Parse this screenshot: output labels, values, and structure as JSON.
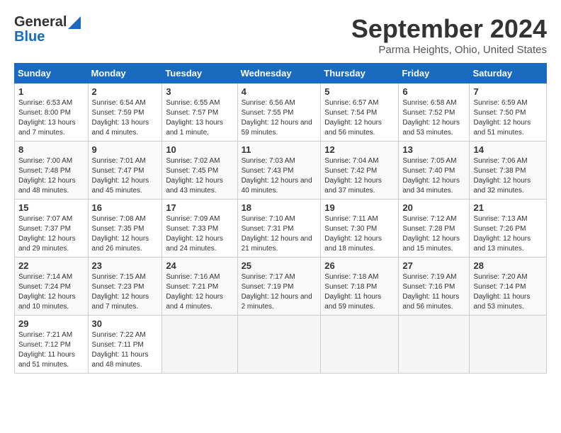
{
  "header": {
    "logo_general": "General",
    "logo_blue": "Blue",
    "title": "September 2024",
    "location": "Parma Heights, Ohio, United States"
  },
  "days_of_week": [
    "Sunday",
    "Monday",
    "Tuesday",
    "Wednesday",
    "Thursday",
    "Friday",
    "Saturday"
  ],
  "weeks": [
    [
      {
        "day": 1,
        "sunrise": "6:53 AM",
        "sunset": "8:00 PM",
        "daylight": "13 hours and 7 minutes"
      },
      {
        "day": 2,
        "sunrise": "6:54 AM",
        "sunset": "7:59 PM",
        "daylight": "13 hours and 4 minutes"
      },
      {
        "day": 3,
        "sunrise": "6:55 AM",
        "sunset": "7:57 PM",
        "daylight": "13 hours and 1 minute"
      },
      {
        "day": 4,
        "sunrise": "6:56 AM",
        "sunset": "7:55 PM",
        "daylight": "12 hours and 59 minutes"
      },
      {
        "day": 5,
        "sunrise": "6:57 AM",
        "sunset": "7:54 PM",
        "daylight": "12 hours and 56 minutes"
      },
      {
        "day": 6,
        "sunrise": "6:58 AM",
        "sunset": "7:52 PM",
        "daylight": "12 hours and 53 minutes"
      },
      {
        "day": 7,
        "sunrise": "6:59 AM",
        "sunset": "7:50 PM",
        "daylight": "12 hours and 51 minutes"
      }
    ],
    [
      {
        "day": 8,
        "sunrise": "7:00 AM",
        "sunset": "7:48 PM",
        "daylight": "12 hours and 48 minutes"
      },
      {
        "day": 9,
        "sunrise": "7:01 AM",
        "sunset": "7:47 PM",
        "daylight": "12 hours and 45 minutes"
      },
      {
        "day": 10,
        "sunrise": "7:02 AM",
        "sunset": "7:45 PM",
        "daylight": "12 hours and 43 minutes"
      },
      {
        "day": 11,
        "sunrise": "7:03 AM",
        "sunset": "7:43 PM",
        "daylight": "12 hours and 40 minutes"
      },
      {
        "day": 12,
        "sunrise": "7:04 AM",
        "sunset": "7:42 PM",
        "daylight": "12 hours and 37 minutes"
      },
      {
        "day": 13,
        "sunrise": "7:05 AM",
        "sunset": "7:40 PM",
        "daylight": "12 hours and 34 minutes"
      },
      {
        "day": 14,
        "sunrise": "7:06 AM",
        "sunset": "7:38 PM",
        "daylight": "12 hours and 32 minutes"
      }
    ],
    [
      {
        "day": 15,
        "sunrise": "7:07 AM",
        "sunset": "7:37 PM",
        "daylight": "12 hours and 29 minutes"
      },
      {
        "day": 16,
        "sunrise": "7:08 AM",
        "sunset": "7:35 PM",
        "daylight": "12 hours and 26 minutes"
      },
      {
        "day": 17,
        "sunrise": "7:09 AM",
        "sunset": "7:33 PM",
        "daylight": "12 hours and 24 minutes"
      },
      {
        "day": 18,
        "sunrise": "7:10 AM",
        "sunset": "7:31 PM",
        "daylight": "12 hours and 21 minutes"
      },
      {
        "day": 19,
        "sunrise": "7:11 AM",
        "sunset": "7:30 PM",
        "daylight": "12 hours and 18 minutes"
      },
      {
        "day": 20,
        "sunrise": "7:12 AM",
        "sunset": "7:28 PM",
        "daylight": "12 hours and 15 minutes"
      },
      {
        "day": 21,
        "sunrise": "7:13 AM",
        "sunset": "7:26 PM",
        "daylight": "12 hours and 13 minutes"
      }
    ],
    [
      {
        "day": 22,
        "sunrise": "7:14 AM",
        "sunset": "7:24 PM",
        "daylight": "12 hours and 10 minutes"
      },
      {
        "day": 23,
        "sunrise": "7:15 AM",
        "sunset": "7:23 PM",
        "daylight": "12 hours and 7 minutes"
      },
      {
        "day": 24,
        "sunrise": "7:16 AM",
        "sunset": "7:21 PM",
        "daylight": "12 hours and 4 minutes"
      },
      {
        "day": 25,
        "sunrise": "7:17 AM",
        "sunset": "7:19 PM",
        "daylight": "12 hours and 2 minutes"
      },
      {
        "day": 26,
        "sunrise": "7:18 AM",
        "sunset": "7:18 PM",
        "daylight": "11 hours and 59 minutes"
      },
      {
        "day": 27,
        "sunrise": "7:19 AM",
        "sunset": "7:16 PM",
        "daylight": "11 hours and 56 minutes"
      },
      {
        "day": 28,
        "sunrise": "7:20 AM",
        "sunset": "7:14 PM",
        "daylight": "11 hours and 53 minutes"
      }
    ],
    [
      {
        "day": 29,
        "sunrise": "7:21 AM",
        "sunset": "7:12 PM",
        "daylight": "11 hours and 51 minutes"
      },
      {
        "day": 30,
        "sunrise": "7:22 AM",
        "sunset": "7:11 PM",
        "daylight": "11 hours and 48 minutes"
      },
      null,
      null,
      null,
      null,
      null
    ]
  ]
}
